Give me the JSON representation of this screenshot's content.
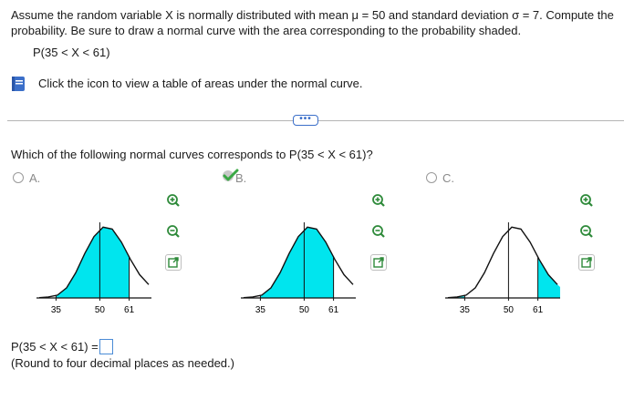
{
  "problem": {
    "line1": "Assume the random variable X is normally distributed with mean μ = 50 and standard deviation σ = 7. Compute the",
    "line2": "probability. Be sure to draw a normal curve with the area corresponding to the probability shaded.",
    "expression": "P(35 < X < 61)"
  },
  "help": {
    "icon": "book-icon",
    "text": "Click the icon to view a table of areas under the normal curve."
  },
  "expand_button": {
    "label": "•••"
  },
  "question": {
    "text": "Which of the following normal curves corresponds to P(35 < X < 61)?",
    "options": [
      {
        "label": "A.",
        "selected": false,
        "ticks": [
          "35",
          "50",
          "61"
        ],
        "shading": "between",
        "zoom_in_icon": "zoom-in-icon",
        "zoom_out_icon": "zoom-out-icon",
        "popout_icon": "popout-icon"
      },
      {
        "label": "B.",
        "selected": true,
        "ticks": [
          "35",
          "50",
          "61"
        ],
        "shading": "between",
        "zoom_in_icon": "zoom-in-icon",
        "zoom_out_icon": "zoom-out-icon",
        "popout_icon": "popout-icon"
      },
      {
        "label": "C.",
        "selected": false,
        "ticks": [
          "35",
          "50",
          "61"
        ],
        "shading": "tails",
        "zoom_in_icon": "zoom-in-icon",
        "zoom_out_icon": "zoom-out-icon",
        "popout_icon": "popout-icon"
      }
    ]
  },
  "answer": {
    "prefix": "P(35 < X < 61) =",
    "value": "",
    "hint": "(Round to four decimal places as needed.)"
  },
  "colors": {
    "shade": "#00e5ee",
    "accent": "#3b6fc9",
    "correct": "#3aa845"
  }
}
